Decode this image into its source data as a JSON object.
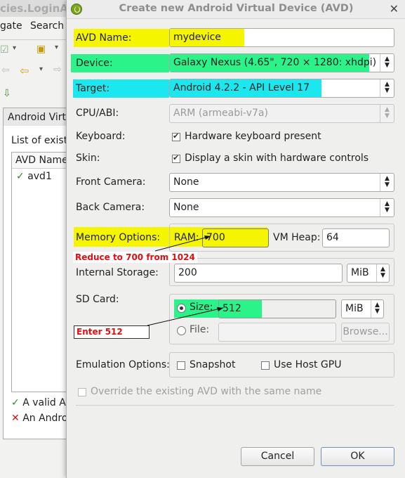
{
  "background": {
    "title": "cies.LoginAct",
    "menu": [
      "gate",
      "Search"
    ],
    "panel_tab": "Android Virtu",
    "list_label": "List of exist",
    "table_header": "AVD Name",
    "rows": [
      "avd1"
    ],
    "status_valid": "A valid A",
    "status_error": "An Andro"
  },
  "dialog": {
    "title": "Create new Android Virtual Device (AVD)",
    "avd_name_label": "AVD Name:",
    "avd_name_value": "mydevice",
    "device_label": "Device:",
    "device_value": "Galaxy Nexus (4.65\", 720 × 1280: xhdpi)",
    "target_label": "Target:",
    "target_value": "Android 4.2.2 - API Level 17",
    "cpu_label": "CPU/ABI:",
    "cpu_value": "ARM (armeabi-v7a)",
    "keyboard_label": "Keyboard:",
    "keyboard_check": "Hardware keyboard present",
    "skin_label": "Skin:",
    "skin_check": "Display a skin with hardware controls",
    "front_camera_label": "Front Camera:",
    "front_camera_value": "None",
    "back_camera_label": "Back Camera:",
    "back_camera_value": "None",
    "memory_label": "Memory Options:",
    "ram_label": "RAM:",
    "ram_value": "700",
    "vm_heap_label": "VM Heap:",
    "vm_heap_value": "64",
    "internal_label": "Internal Storage:",
    "internal_value": "200",
    "internal_unit": "MiB",
    "sd_label": "SD Card:",
    "size_label": "Size:",
    "size_value": "512",
    "size_unit": "MiB",
    "file_label": "File:",
    "browse_label": "Browse...",
    "emulation_label": "Emulation Options:",
    "snapshot_label": "Snapshot",
    "host_gpu_label": "Use Host GPU",
    "override_label": "Override the existing AVD with the same name",
    "cancel_label": "Cancel",
    "ok_label": "OK"
  },
  "annotations": {
    "ram_note": "Reduce to 700 from 1024",
    "sd_note": "Enter 512"
  },
  "colors": {
    "highlight_yellow": "#f5f500",
    "highlight_green": "#2cf28a",
    "highlight_cyan": "#1ce6ee",
    "annotation_red": "#e01010"
  }
}
